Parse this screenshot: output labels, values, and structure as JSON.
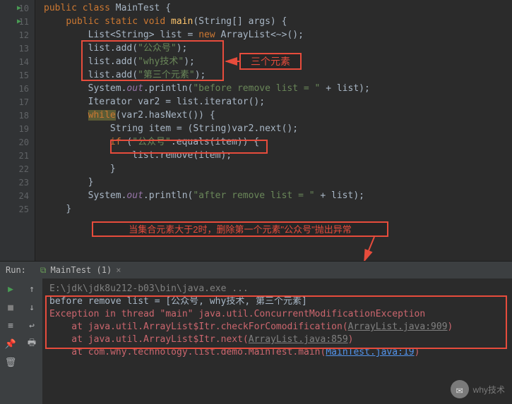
{
  "gutter": {
    "start": 10,
    "end": 25,
    "run_markers": [
      10,
      11
    ]
  },
  "code": {
    "l10": {
      "kw1": "public class ",
      "cls": "MainTest",
      "p": " {"
    },
    "l11": {
      "kw1": "public static void ",
      "m": "main",
      "p1": "(",
      "cls": "String",
      "p2": "[] args) {"
    },
    "l12": {
      "cls1": "List",
      "p1": "<",
      "cls2": "String",
      "p2": "> list = ",
      "kw": "new ",
      "cls3": "ArrayList",
      "p3": "<~>();"
    },
    "l13": {
      "t1": "list.add(",
      "s": "\"公众号\"",
      "t2": ");"
    },
    "l14": {
      "t1": "list.add(",
      "s": "\"why技术\"",
      "t2": ");"
    },
    "l15": {
      "t1": "list.add(",
      "s": "\"第三个元素\"",
      "t2": ");"
    },
    "l16": {
      "t1": "System.",
      "f": "out",
      "t2": ".println(",
      "s": "\"before remove list = \"",
      "t3": " + list);"
    },
    "l17": {
      "cls": "Iterator",
      "t": " var2 = list.iterator();"
    },
    "l18": {
      "kw": "while",
      "t": "(var2.hasNext()) {"
    },
    "l19": {
      "cls": "String",
      "t1": " item = (",
      "cls2": "String",
      "t2": ")var2.next();"
    },
    "l20": {
      "kw": "if ",
      "p1": "(",
      "s": "\"公众号\"",
      "t": ".equals(item)) {"
    },
    "l21": {
      "t": "list.remove(item);"
    },
    "l22": {
      "t": "}"
    },
    "l23": {
      "t": "}"
    },
    "l24": {
      "t1": "System.",
      "f": "out",
      "t2": ".println(",
      "s": "\"after remove list = \"",
      "t3": " + list);"
    },
    "l25": {
      "t": "}"
    }
  },
  "annotations": {
    "anno1": "三个元素",
    "anno2": "当集合元素大于2时，删除第一个元素\"公众号\"抛出异常"
  },
  "run": {
    "label": "Run:",
    "tab": "MainTest (1)"
  },
  "console": {
    "cmd": "E:\\jdk\\jdk8u212-b03\\bin\\java.exe ...",
    "out1": "before remove list = [公众号, why技术, 第三个元素]",
    "err1": "Exception in thread \"main\" java.util.ConcurrentModificationException",
    "err2a": "    at java.util.ArrayList$Itr.checkForComodification(",
    "err2b": "ArrayList.java:909",
    "err2c": ")",
    "err3a": "    at java.util.ArrayList$Itr.next(",
    "err3b": "ArrayList.java:859",
    "err3c": ")",
    "err4a": "    at com.why.technology.list.demo.MainTest.main(",
    "err4b": "MainTest.java:19",
    "err4c": ")"
  },
  "watermark": "why技术"
}
